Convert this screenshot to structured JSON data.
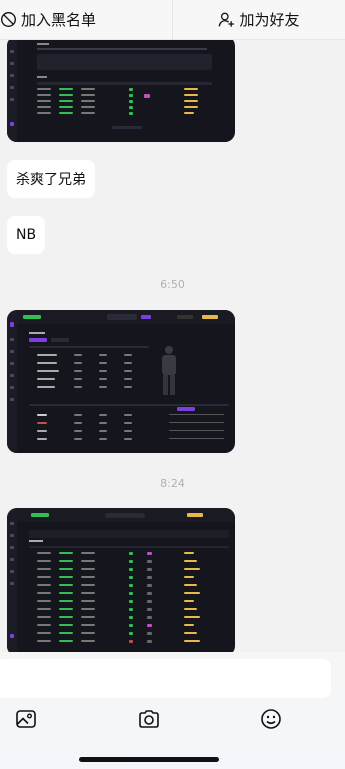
{
  "topbar": {
    "block_label": "加入黑名单",
    "add_friend_label": "加为好友"
  },
  "messages": [
    {
      "type": "image",
      "description_id": "game-screenshot-history-table"
    },
    {
      "type": "text",
      "text": "杀爽了兄弟"
    },
    {
      "type": "text",
      "text": "NB"
    },
    {
      "type": "time",
      "text": "6:50"
    },
    {
      "type": "image",
      "description_id": "game-screenshot-loadout"
    },
    {
      "type": "time",
      "text": "8:24"
    },
    {
      "type": "image",
      "description_id": "game-screenshot-match-list"
    }
  ],
  "chat": {
    "msg1": "杀爽了兄弟",
    "msg2": "NB",
    "time1": "6:50",
    "time2": "8:24"
  },
  "input": {
    "value": "",
    "placeholder": ""
  },
  "toolbar": {
    "icons": [
      "image-icon",
      "camera-icon",
      "emoji-icon"
    ]
  },
  "colors": {
    "game_bg": "#15151d",
    "accent_purple": "#7b3fe4",
    "accent_green": "#2fbf55",
    "star_yellow": "#e8b84a"
  }
}
